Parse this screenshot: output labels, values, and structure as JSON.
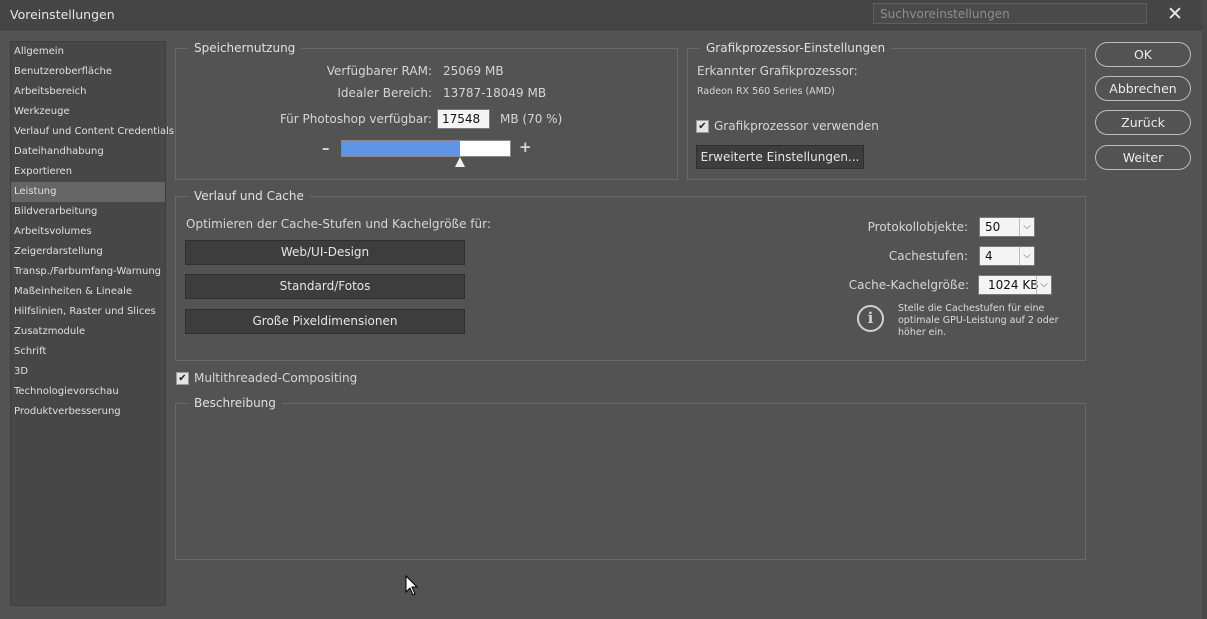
{
  "window": {
    "title": "Voreinstellungen",
    "search_placeholder": "Suchvoreinstellungen",
    "close_glyph": "✕"
  },
  "sidebar": {
    "items": [
      {
        "label": "Allgemein"
      },
      {
        "label": "Benutzeroberfläche"
      },
      {
        "label": "Arbeitsbereich"
      },
      {
        "label": "Werkzeuge"
      },
      {
        "label": "Verlauf und Content Credentials"
      },
      {
        "label": "Dateihandhabung"
      },
      {
        "label": "Exportieren"
      },
      {
        "label": "Leistung",
        "active": true
      },
      {
        "label": "Bildverarbeitung"
      },
      {
        "label": "Arbeitsvolumes"
      },
      {
        "label": "Zeigerdarstellung"
      },
      {
        "label": "Transp./Farbumfang-Warnung"
      },
      {
        "label": "Maßeinheiten & Lineale"
      },
      {
        "label": "Hilfslinien, Raster und Slices"
      },
      {
        "label": "Zusatzmodule"
      },
      {
        "label": "Schrift"
      },
      {
        "label": "3D"
      },
      {
        "label": "Technologievorschau"
      },
      {
        "label": "Produktverbesserung"
      }
    ]
  },
  "memory": {
    "legend": "Speichernutzung",
    "available_label": "Verfügbarer RAM:",
    "available_value": "25069 MB",
    "ideal_label": "Idealer Bereich:",
    "ideal_value": "13787-18049 MB",
    "photoshop_label": "Für Photoshop verfügbar:",
    "photoshop_value": "17548",
    "photoshop_unit": "MB (70 %)",
    "minus": "–",
    "plus": "+",
    "slider_fraction": 0.7
  },
  "gpu": {
    "legend": "Grafikprozessor-Einstellungen",
    "detected_label": "Erkannter Grafikprozessor:",
    "detected_value": "Radeon RX 560 Series (AMD)",
    "use_gpu_label": "Grafikprozessor verwenden",
    "use_gpu_checked": "✔",
    "advanced_button": "Erweiterte Einstellungen..."
  },
  "cache": {
    "legend": "Verlauf und Cache",
    "optimize_label": "Optimieren der Cache-Stufen und Kachelgröße für:",
    "buttons": [
      "Web/UI-Design",
      "Standard/Fotos",
      "Große Pixeldimensionen"
    ],
    "history_label": "Protokollobjekte:",
    "history_value": "50",
    "levels_label": "Cachestufen:",
    "levels_value": "4",
    "tile_label": "Cache-Kachelgröße:",
    "tile_value": "1024 KB",
    "info_icon": "i",
    "info_text": "Stelle die Cachestufen für eine optimale GPU-Leistung auf 2 oder höher ein."
  },
  "multithread": {
    "label": "Multithreaded-Compositing",
    "checked": "✔"
  },
  "description": {
    "legend": "Beschreibung"
  },
  "actions": {
    "ok": "OK",
    "cancel": "Abbrechen",
    "back": "Zurück",
    "next": "Weiter"
  },
  "dropdown_glyph": "⌵"
}
